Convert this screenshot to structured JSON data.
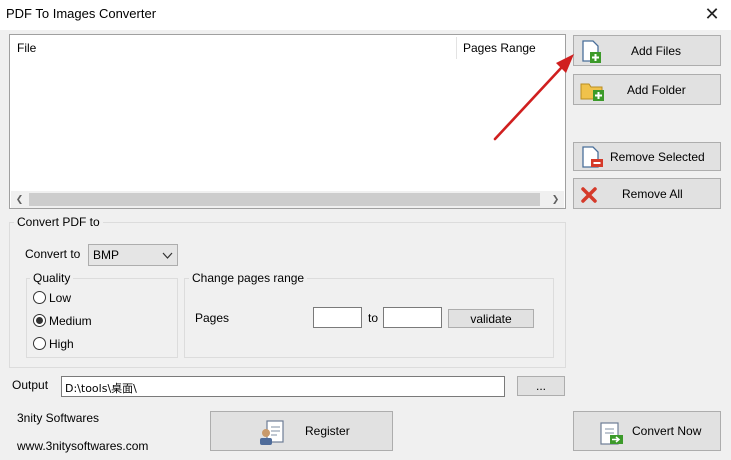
{
  "window": {
    "title": "PDF To Images Converter",
    "close_glyph": "✕"
  },
  "list": {
    "columns": {
      "file": "File",
      "pages_range": "Pages Range"
    }
  },
  "buttons": {
    "add_files": "Add Files",
    "add_folder": "Add Folder",
    "remove_selected": "Remove Selected",
    "remove_all": "Remove All",
    "validate": "validate",
    "browse": "...",
    "register": "Register",
    "convert_now": "Convert Now"
  },
  "convert": {
    "group_title": "Convert PDF to",
    "convert_to_label": "Convert to",
    "format_value": "BMP",
    "quality_title": "Quality",
    "quality_options": [
      "Low",
      "Medium",
      "High"
    ],
    "quality_selected": "Medium"
  },
  "pages_range": {
    "group_title": "Change pages range",
    "pages_label": "Pages",
    "to_label": "to",
    "from_value": "",
    "to_value": ""
  },
  "output": {
    "label": "Output",
    "path": "D:\\tools\\桌面\\"
  },
  "footer": {
    "company": "3nity Softwares",
    "website": "www.3nitysoftwares.com"
  },
  "colors": {
    "arrow": "#d01f1f",
    "add_icon": "#3c9a2a",
    "remove_icon": "#d53a2a",
    "folder": "#f0c24b"
  }
}
